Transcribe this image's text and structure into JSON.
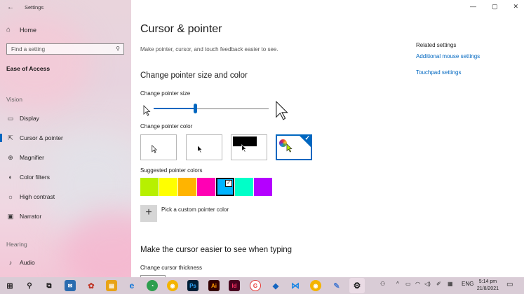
{
  "window": {
    "title": "Settings",
    "back_glyph": "←",
    "min_glyph": "—",
    "max_glyph": "▢",
    "close_glyph": "✕"
  },
  "sidebar": {
    "home": {
      "label": "Home",
      "icon": "home-icon"
    },
    "search": {
      "placeholder": "Find a setting",
      "icon": "search-icon"
    },
    "section": "Ease of Access",
    "groups": [
      {
        "label": "Vision"
      },
      {
        "label": "Hearing"
      }
    ],
    "items": [
      {
        "label": "Display",
        "icon": "display-icon"
      },
      {
        "label": "Cursor & pointer",
        "icon": "cursor-pointer-icon",
        "active": true
      },
      {
        "label": "Magnifier",
        "icon": "magnifier-icon"
      },
      {
        "label": "Color filters",
        "icon": "color-filters-icon"
      },
      {
        "label": "High contrast",
        "icon": "high-contrast-icon"
      },
      {
        "label": "Narrator",
        "icon": "narrator-icon"
      },
      {
        "label": "Audio",
        "icon": "audio-icon"
      }
    ]
  },
  "main": {
    "title": "Cursor & pointer",
    "subtitle": "Make pointer, cursor, and touch feedback easier to see.",
    "size_color_heading": "Change pointer size and color",
    "size_label": "Change pointer size",
    "size_level": 0.36,
    "color_label": "Change pointer color",
    "color_options": [
      {
        "name": "white",
        "selected": false
      },
      {
        "name": "black",
        "selected": false
      },
      {
        "name": "inverted",
        "selected": false
      },
      {
        "name": "custom",
        "selected": true
      }
    ],
    "suggested_label": "Suggested pointer colors",
    "suggested_colors": [
      "#b7f000",
      "#ffff00",
      "#ffb400",
      "#ff00b4",
      "#00b4ff",
      "#00ffc8",
      "#b400ff"
    ],
    "suggested_selected_index": 4,
    "custom_color_label": "Pick a custom pointer color",
    "typing_heading": "Make the cursor easier to see when typing",
    "thickness_label": "Change cursor thickness"
  },
  "related": {
    "heading": "Related settings",
    "links": [
      "Additional mouse settings",
      "Touchpad settings"
    ]
  },
  "taskbar": {
    "language": "ENG",
    "time": "5:14 pm",
    "date": "21/8/2021"
  },
  "colors": {
    "accent": "#0067c0"
  }
}
